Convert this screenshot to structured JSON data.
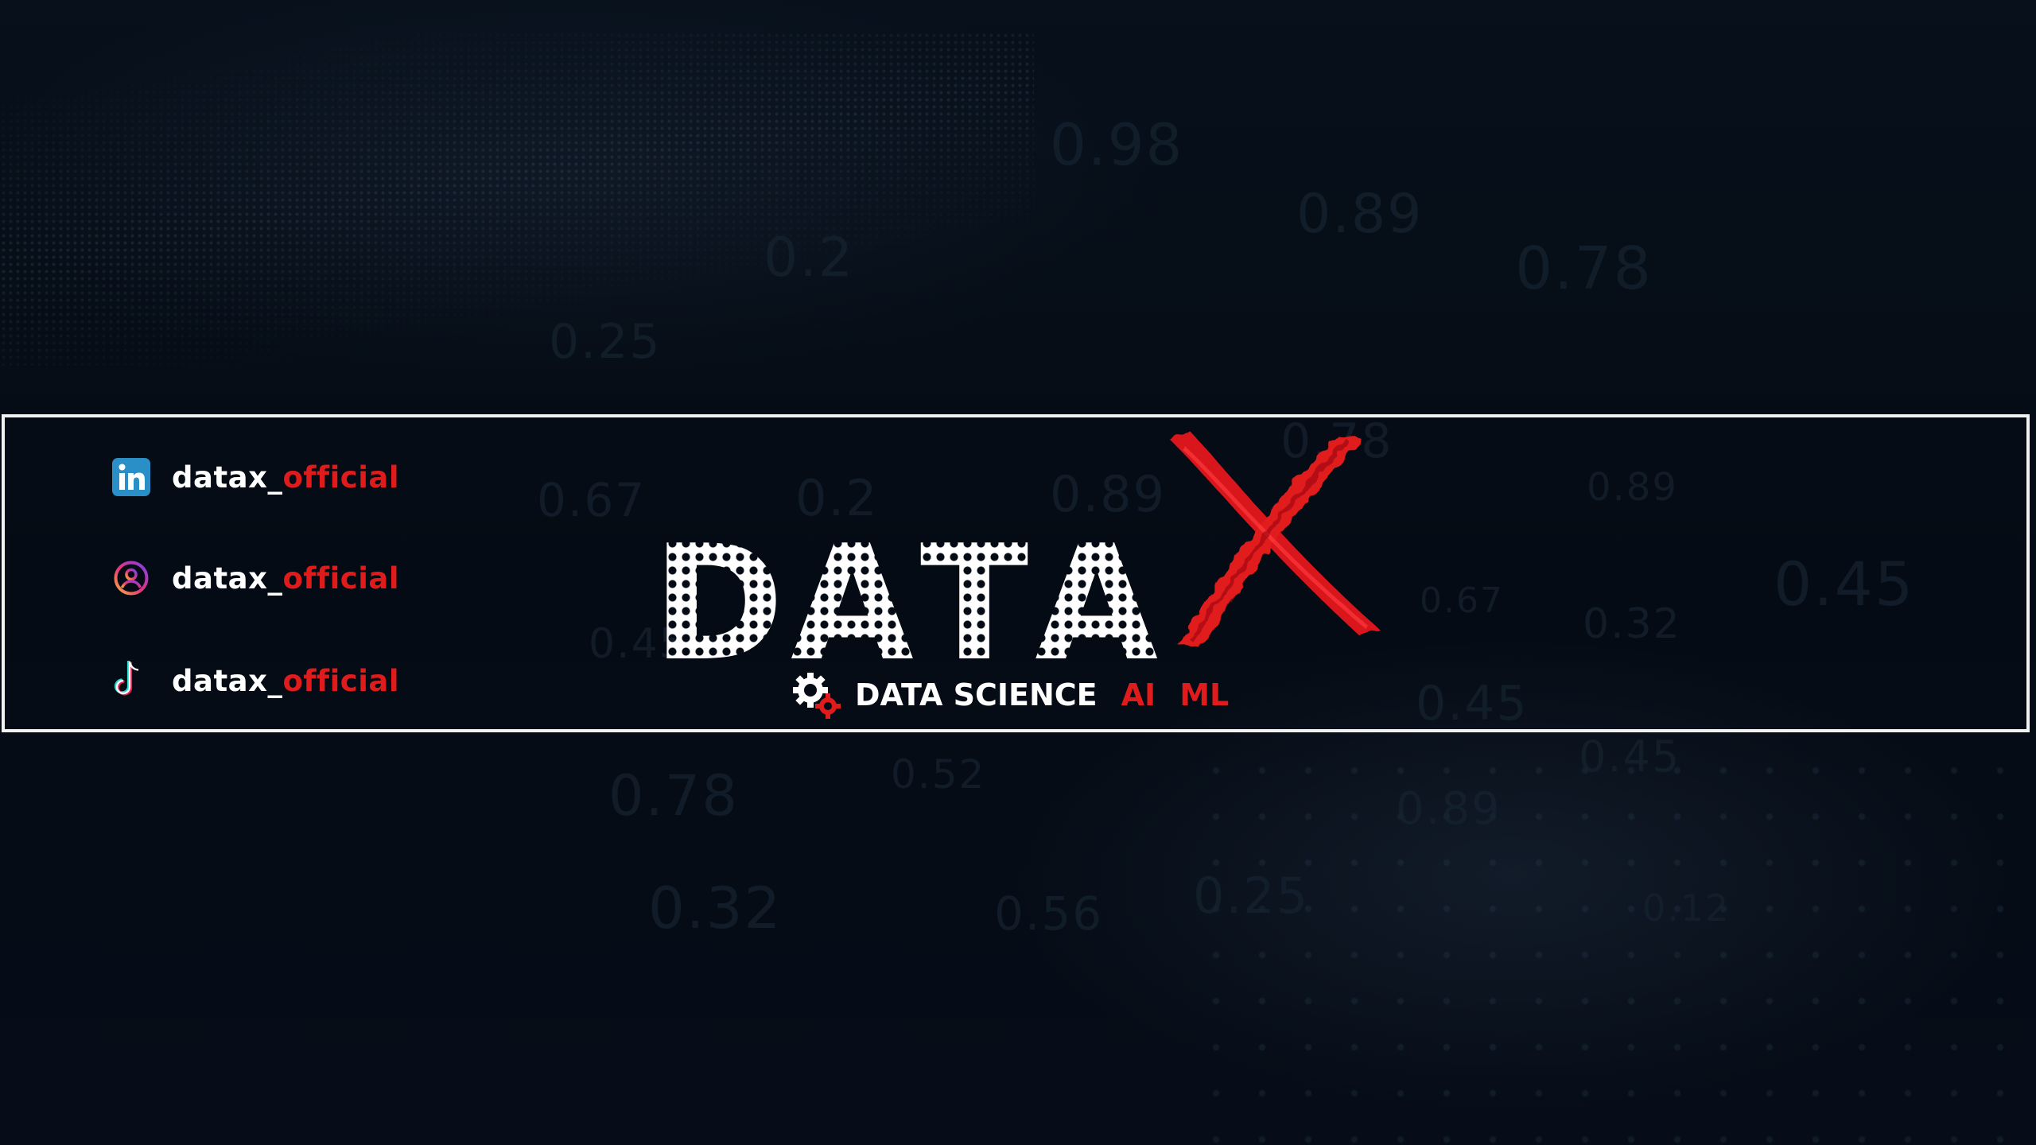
{
  "banner": {
    "background_digits": [
      "0.98",
      "0.89",
      "0.2",
      "0.78",
      "0.25",
      "0.67",
      "0.2",
      "0.89",
      "0.78",
      "0.89",
      "0.45",
      "0.45",
      "0.67",
      "0.32",
      "0.45",
      "0.78",
      "0.52",
      "0.89",
      "0.45",
      "0.32",
      "0.56",
      "0.25",
      "0.12"
    ],
    "colors": {
      "background": "#050b14",
      "accent_red": "#e01b1b",
      "frame": "#f2f2f2",
      "text": "#ffffff",
      "linkedin_blue": "#2a8fc7"
    }
  },
  "socials": [
    {
      "icon": "linkedin-icon",
      "handle_prefix": "datax_",
      "handle_accent": "official"
    },
    {
      "icon": "instagram-icon",
      "handle_prefix": "datax_",
      "handle_accent": "official"
    },
    {
      "icon": "tiktok-icon",
      "handle_prefix": "datax_",
      "handle_accent": "official"
    }
  ],
  "logo": {
    "letters": [
      "D",
      "A",
      "T",
      "A"
    ],
    "x_letter": "X",
    "icon": "gear-icon"
  },
  "tagline": {
    "main": "DATA SCIENCE",
    "tag1": "AI",
    "tag2": "ML"
  }
}
